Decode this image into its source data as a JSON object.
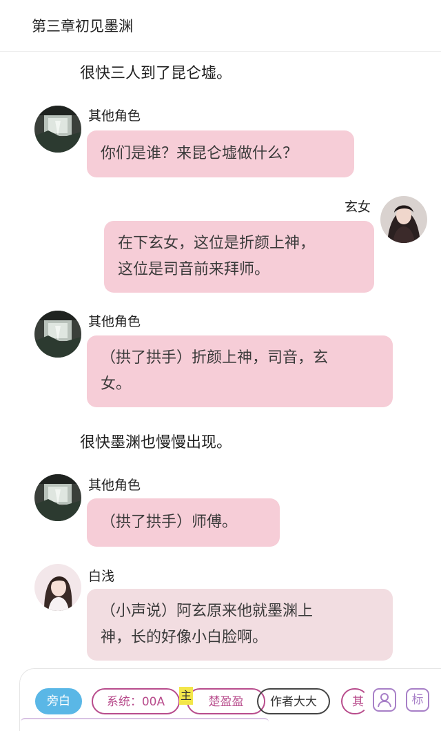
{
  "chapter": {
    "title": "第三章初见墨渊"
  },
  "messages": [
    {
      "kind": "narration",
      "text": "很快三人到了昆仑墟。"
    },
    {
      "kind": "bubble",
      "speaker": "其他角色",
      "avatar": "landscape-avatar",
      "lines": [
        "你们是谁？来昆仑墟做什么？"
      ]
    },
    {
      "kind": "bubble",
      "speaker": "玄女",
      "avatar": "woman-avatar",
      "side": "right",
      "lines": [
        "在下玄女，这位是折颜上神，",
        "这位是司音前来拜师。"
      ]
    },
    {
      "kind": "bubble",
      "speaker": "其他角色",
      "avatar": "landscape-avatar",
      "lines": [
        "（拱了拱手）折颜上神，司音，玄",
        "女。"
      ]
    },
    {
      "kind": "narration",
      "text": "很快墨渊也慢慢出现。"
    },
    {
      "kind": "bubble",
      "speaker": "其他角色",
      "avatar": "landscape-avatar",
      "lines": [
        "（拱了拱手）师傅。"
      ]
    },
    {
      "kind": "bubble",
      "speaker": "白浅",
      "avatar": "girl-avatar",
      "lines": [
        "（小声说）阿玄原来他就墨渊上",
        "神，长的好像小白脸啊。"
      ]
    }
  ],
  "toolbar": {
    "narration_chip": "旁白",
    "system_chip": "系统：00A",
    "main_badge": "主",
    "chuyingying_chip": "楚盈盈",
    "author_chip": "作者大大",
    "cut_chip": "其",
    "person_icon": "person-icon",
    "mark_button": "标"
  },
  "colors": {
    "bubble_pink": "#f6cdd7",
    "bubble_light": "#f2dde1",
    "narration_chip": "#5ab7e6",
    "chip_border": "#b84c8c",
    "tool_border": "#a77fc7"
  }
}
